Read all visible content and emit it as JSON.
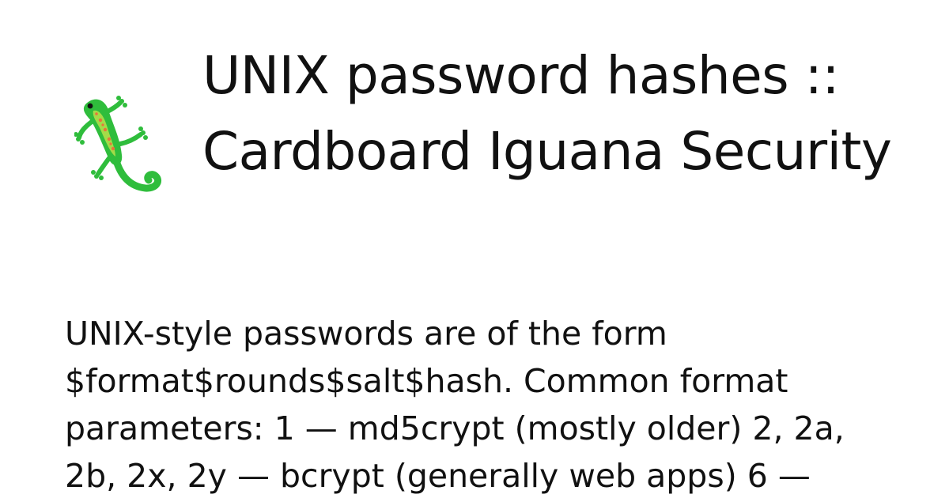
{
  "site": {
    "logo_icon": "lizard-icon",
    "title": "UNIX password hashes :: Cardboard Iguana Security"
  },
  "article": {
    "description": "UNIX-style passwords are of the form $format$rounds$salt$hash. Common format parameters: 1 — md5crypt (mostly older) 2, 2a, 2b, 2x, 2y — bcrypt (generally web apps) 6 —"
  },
  "colors": {
    "background": "#ffffff",
    "text": "#111111",
    "lizard_body": "#2fbd3c",
    "lizard_belly": "#b7e04a",
    "lizard_spots": "#e8743b"
  }
}
